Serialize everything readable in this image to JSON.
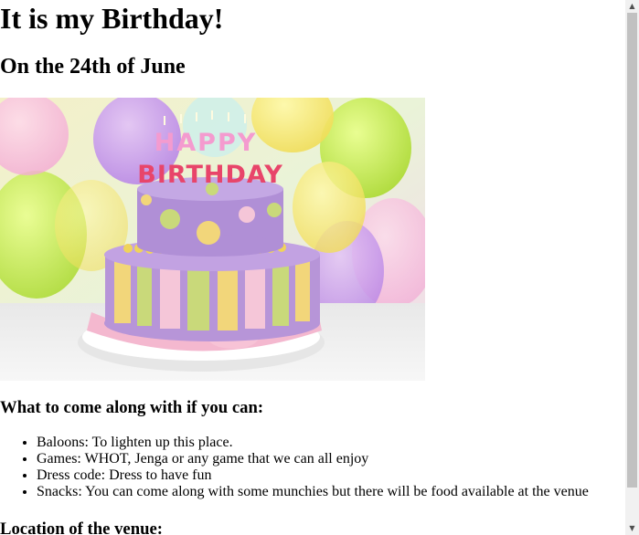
{
  "page": {
    "title": "It is my Birthday!",
    "subtitle": "On the 24th of June"
  },
  "hero_image": {
    "alt": "Birthday cake with HAPPY BIRTHDAY candles",
    "candles_line1": "HAPPY",
    "candles_line2": "BIRTHDAY"
  },
  "bring_section": {
    "heading": "What to come along with if you can:",
    "items": [
      "Baloons: To lighten up this place.",
      "Games: WHOT, Jenga or any game that we can all enjoy",
      "Dress code: Dress to have fun",
      "Snacks: You can come along with some munchies but there will be food available at the venue"
    ]
  },
  "venue_section": {
    "heading": "Location of the venue:"
  },
  "scrollbar": {
    "up_icon": "triangle-up-icon",
    "down_icon": "triangle-down-icon"
  }
}
